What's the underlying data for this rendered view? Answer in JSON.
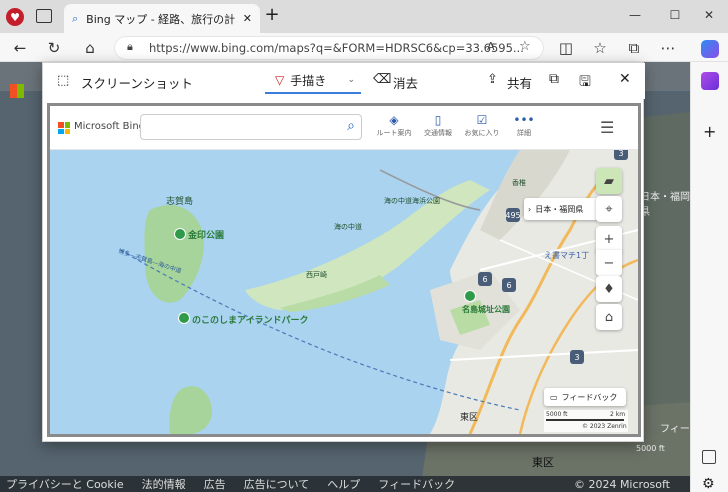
{
  "tab": {
    "title": "Bing マップ - 経路、旅行の計画、交"
  },
  "window": {
    "minimize": "—",
    "maximize": "☐",
    "close": "✕"
  },
  "address": {
    "url": "https://www.bing.com/maps?q=&FORM=HDRSC6&cp=33.6595..."
  },
  "dialog": {
    "title": "スクリーンショット",
    "draw_label": "手描き",
    "erase_label": "消去",
    "share_label": "共有"
  },
  "bing": {
    "logo": "Microsoft Bing",
    "search_placeholder": "",
    "buttons": [
      "ルート案内",
      "交通情報",
      "お気に入り",
      "詳細"
    ]
  },
  "map": {
    "places": {
      "shikanoshima": "志賀島",
      "kinin": "金印公園",
      "nokonoshima": "のこのしまアイランドパーク",
      "saitozaki": "西戸崎",
      "umi_nakamichi": "海の中道",
      "nagoya_castle_park": "名島城址公園",
      "minatomachi": "え書マチ1丁",
      "higashi_ku": "東区",
      "kashii": "香椎",
      "marine_park": "海の中道海浜公園"
    },
    "region_button": "日本・福岡県",
    "feedback": "フィードバック",
    "scale_5000": "5000 ft",
    "scale_2km": "2 km",
    "copyright": "© 2023 Zenrin",
    "route_labels": [
      "495",
      "3",
      "6",
      "6",
      "3"
    ],
    "ferry_text": "博多―志賀島―海の中道"
  },
  "background": {
    "region": "日本・福岡県",
    "higashi_ku": "東区",
    "feedback": "フィー",
    "scale": "5000 ft"
  },
  "footer": {
    "links": [
      "プライバシーと Cookie",
      "法的情報",
      "広告",
      "広告について",
      "ヘルプ",
      "フィードバック"
    ],
    "copyright": "© 2024 Microsoft"
  }
}
